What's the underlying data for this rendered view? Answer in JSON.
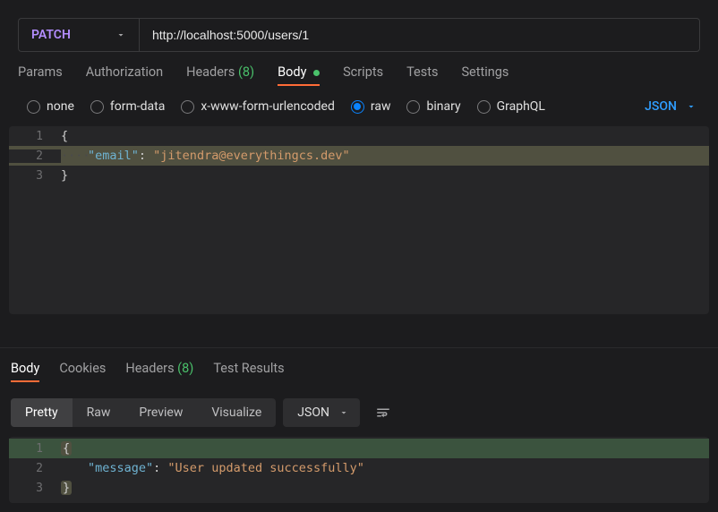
{
  "request": {
    "method": "PATCH",
    "url": "http://localhost:5000/users/1"
  },
  "req_tabs": {
    "params": "Params",
    "authorization": "Authorization",
    "headers_label": "Headers",
    "headers_count": "(8)",
    "body": "Body",
    "scripts": "Scripts",
    "tests": "Tests",
    "settings": "Settings"
  },
  "body_types": {
    "none": "none",
    "form_data": "form-data",
    "urlencoded": "x-www-form-urlencoded",
    "raw": "raw",
    "binary": "binary",
    "graphql": "GraphQL",
    "selected": "raw",
    "format_label": "JSON"
  },
  "request_body": {
    "lines": [
      {
        "n": "1",
        "open": "{"
      },
      {
        "n": "2",
        "key": "\"email\"",
        "colon": ": ",
        "val": "\"jitendra@everythingcs.dev\""
      },
      {
        "n": "3",
        "close": "}"
      }
    ]
  },
  "response_tabs": {
    "body": "Body",
    "cookies": "Cookies",
    "headers_label": "Headers",
    "headers_count": "(8)",
    "test_results": "Test Results"
  },
  "response_view": {
    "pretty": "Pretty",
    "raw": "Raw",
    "preview": "Preview",
    "visualize": "Visualize",
    "format_label": "JSON"
  },
  "response_body": {
    "lines": [
      {
        "n": "1",
        "open": "{"
      },
      {
        "n": "2",
        "key": "\"message\"",
        "colon": ": ",
        "val": "\"User updated successfully\""
      },
      {
        "n": "3",
        "close": "}"
      }
    ]
  }
}
